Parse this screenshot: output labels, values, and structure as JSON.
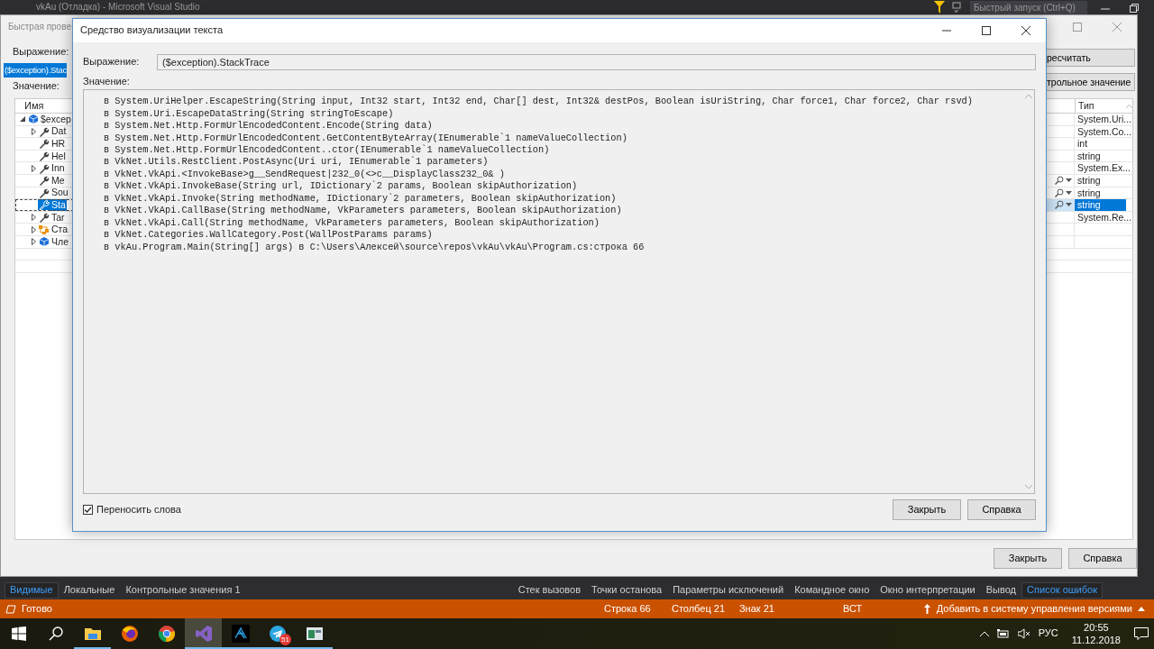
{
  "vs_window": {
    "title": "vkAu (Отладка) - Microsoft Visual Studio",
    "quick_launch": {
      "placeholder": "Быстрый запуск (Ctrl+Q)"
    }
  },
  "quick_watch": {
    "title": "Быстрая прове",
    "expression_label": "Выражение:",
    "expression": "($exception).Stac",
    "value_label": "Значение:",
    "side_buttons": [
      "ресчитать",
      "трольное значение"
    ],
    "tree": {
      "columns": [
        "Имя",
        "Тип"
      ],
      "rows": [
        {
          "name": "$excep",
          "type": "System.Uri...",
          "kind": "object",
          "expanded": true,
          "selected": false,
          "visualizer": false,
          "children": [
            {
              "name": "Dat",
              "type": "System.Co...",
              "kind": "property",
              "expanded": false,
              "selected": false,
              "visualizer": false
            },
            {
              "name": "HR",
              "type": "int",
              "kind": "property",
              "selected": false,
              "visualizer": false
            },
            {
              "name": "Hel",
              "type": "string",
              "kind": "property",
              "selected": false,
              "visualizer": false
            },
            {
              "name": "Inn",
              "type": "System.Ex...",
              "kind": "property",
              "expanded": false,
              "selected": false,
              "visualizer": false
            },
            {
              "name": "Me",
              "type": "string",
              "kind": "property",
              "selected": false,
              "visualizer": true
            },
            {
              "name": "Sou",
              "type": "string",
              "kind": "property",
              "selected": false,
              "visualizer": true
            },
            {
              "name": "Sta",
              "type": "string",
              "kind": "property",
              "selected": true,
              "visualizer": true
            },
            {
              "name": "Tar",
              "type": "System.Re...",
              "kind": "property",
              "expanded": false,
              "selected": false,
              "visualizer": false
            },
            {
              "name": "Ста",
              "kind": "static",
              "expanded": false,
              "selected": false,
              "visualizer": false
            },
            {
              "name": "Чле",
              "kind": "object",
              "expanded": false,
              "selected": false,
              "visualizer": false
            }
          ]
        }
      ]
    },
    "buttons": [
      "Закрыть",
      "Справка"
    ]
  },
  "visualizer": {
    "title": "Средство визуализации текста",
    "expression_label": "Выражение:",
    "expression": "($exception).StackTrace",
    "value_label": "Значение:",
    "lines": [
      "в System.UriHelper.EscapeString(String input, Int32 start, Int32 end, Char[] dest, Int32& destPos, Boolean isUriString, Char force1, Char force2, Char rsvd)",
      "в System.Uri.EscapeDataString(String stringToEscape)",
      "в System.Net.Http.FormUrlEncodedContent.Encode(String data)",
      "в System.Net.Http.FormUrlEncodedContent.GetContentByteArray(IEnumerable`1 nameValueCollection)",
      "в System.Net.Http.FormUrlEncodedContent..ctor(IEnumerable`1 nameValueCollection)",
      "в VkNet.Utils.RestClient.PostAsync(Uri uri, IEnumerable`1 parameters)",
      "в VkNet.VkApi.<InvokeBase>g__SendRequest|232_0(<>c__DisplayClass232_0& )",
      "в VkNet.VkApi.InvokeBase(String url, IDictionary`2 params, Boolean skipAuthorization)",
      "в VkNet.VkApi.Invoke(String methodName, IDictionary`2 parameters, Boolean skipAuthorization)",
      "в VkNet.VkApi.CallBase(String methodName, VkParameters parameters, Boolean skipAuthorization)",
      "в VkNet.VkApi.Call(String methodName, VkParameters parameters, Boolean skipAuthorization)",
      "в VkNet.Categories.WallCategory.Post(WallPostParams params)",
      "в vkAu.Program.Main(String[] args) в C:\\Users\\Алексей\\source\\repos\\vkAu\\vkAu\\Program.cs:строка 66"
    ],
    "word_wrap": {
      "label": "Переносить слова",
      "checked": true
    },
    "buttons": [
      "Закрыть",
      "Справка"
    ]
  },
  "tool_tabs_left": [
    {
      "label": "Видимые",
      "selected": true
    },
    {
      "label": "Локальные",
      "selected": false
    },
    {
      "label": "Контрольные значения 1",
      "selected": false
    }
  ],
  "tool_tabs_right": [
    {
      "label": "Стек вызовов",
      "selected": false
    },
    {
      "label": "Точки останова",
      "selected": false
    },
    {
      "label": "Параметры исключений",
      "selected": false
    },
    {
      "label": "Командное окно",
      "selected": false
    },
    {
      "label": "Окно интерпретации",
      "selected": false
    },
    {
      "label": "Вывод",
      "selected": false
    },
    {
      "label": "Список ошибок",
      "selected": true
    }
  ],
  "status_bar": {
    "ready": "Готово",
    "items": [
      "Строка 66",
      "Столбец 21",
      "Знак 21",
      "ВСТ"
    ],
    "source_control": "Добавить в систему управления версиями"
  },
  "taskbar": {
    "apps": [
      {
        "kind": "folder",
        "active": false,
        "running": true
      },
      {
        "kind": "firefox",
        "active": false,
        "running": false
      },
      {
        "kind": "chrome",
        "active": false,
        "running": false
      },
      {
        "kind": "studio",
        "active": true,
        "running": true
      },
      {
        "kind": "dark",
        "active": false,
        "running": true
      },
      {
        "kind": "telegram",
        "active": false,
        "running": true,
        "badge": "51"
      },
      {
        "kind": "window",
        "active": false,
        "running": true
      }
    ],
    "language": "РУС",
    "time": "20:55",
    "date": "11.12.2018"
  }
}
